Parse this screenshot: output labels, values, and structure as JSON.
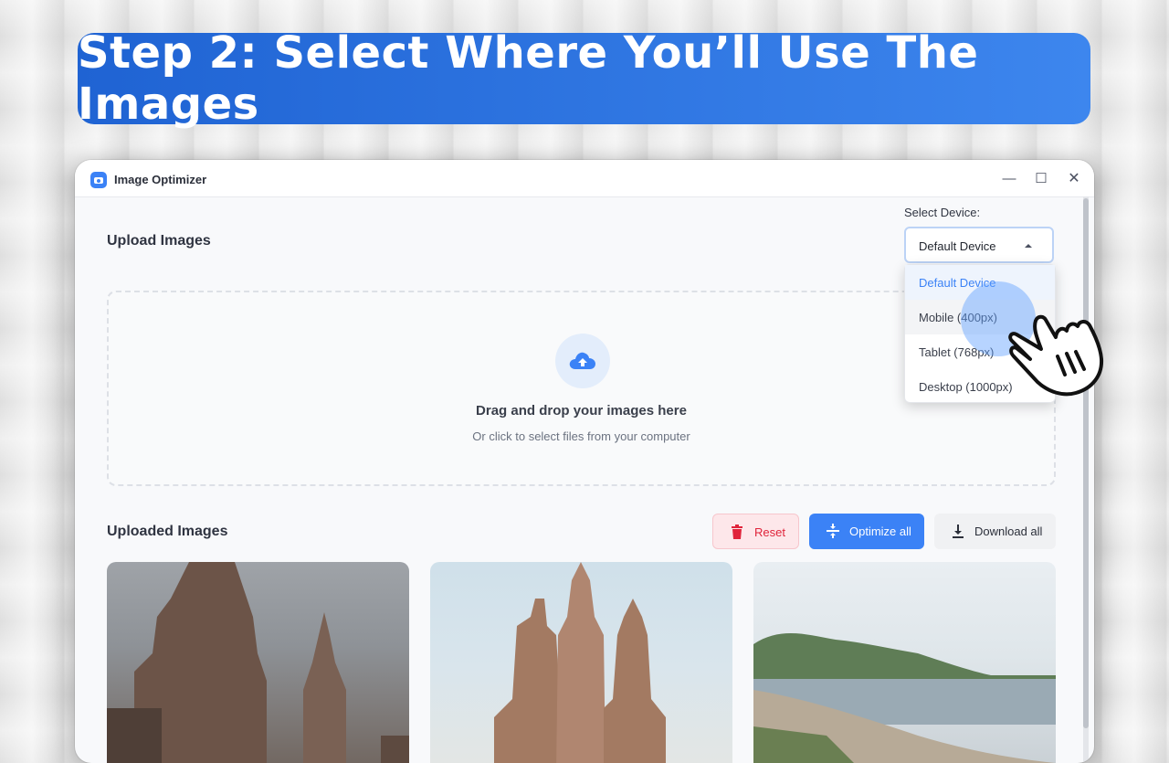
{
  "banner": {
    "title": "Step 2: Select Where You’ll Use The Images"
  },
  "window": {
    "title": "Image Optimizer",
    "controls": {
      "minimize": "—",
      "maximize": "☐",
      "close": "✕"
    }
  },
  "upload": {
    "heading": "Upload Images",
    "dropzone_main": "Drag and drop your images here",
    "dropzone_sub": "Or click to select files from your computer"
  },
  "device": {
    "label": "Select Device:",
    "selected": "Default Device",
    "options": [
      "Default Device",
      "Mobile (400px)",
      "Tablet (768px)",
      "Desktop (1000px)"
    ]
  },
  "uploaded": {
    "heading": "Uploaded Images",
    "reset_label": "Reset",
    "optimize_label": "Optimize all",
    "download_label": "Download all"
  },
  "colors": {
    "accent": "#3b82f6",
    "banner_start": "#1f63d3",
    "banner_end": "#3d86ee",
    "danger": "#e0243b"
  },
  "icons": {
    "app": "image-optimizer-icon",
    "upload": "cloud-upload-icon",
    "reset": "trash-icon",
    "optimize": "compress-icon",
    "download": "download-icon",
    "pointer": "hand-pointer-icon"
  }
}
